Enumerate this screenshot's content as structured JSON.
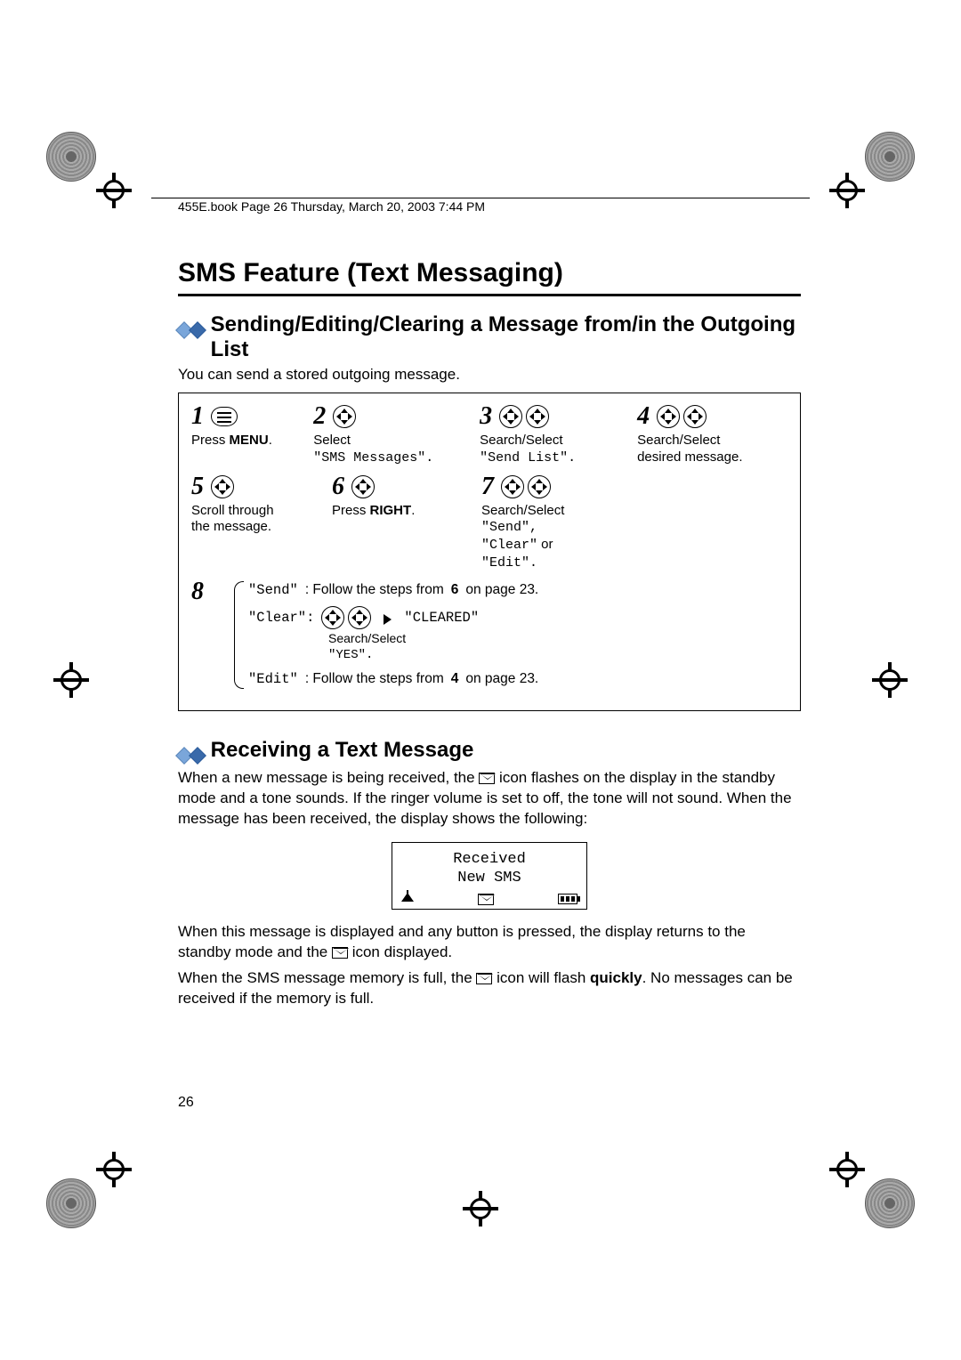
{
  "meta": {
    "running_header": "455E.book  Page 26  Thursday, March 20, 2003  7:44 PM",
    "page_number": "26"
  },
  "title": "SMS Feature (Text Messaging)",
  "section1": {
    "heading": "Sending/Editing/Clearing a Message from/in the Outgoing List",
    "intro": "You can send a stored outgoing message.",
    "steps": {
      "s1": {
        "num": "1",
        "cap_pre": "Press ",
        "cap_bold": "MENU",
        "cap_post": "."
      },
      "s2": {
        "num": "2",
        "cap1": "Select",
        "cap2": "\"SMS Messages\"."
      },
      "s3": {
        "num": "3",
        "cap1": "Search/Select",
        "cap2": "\"Send List\"."
      },
      "s4": {
        "num": "4",
        "cap1": "Search/Select",
        "cap2": "desired message."
      },
      "s5": {
        "num": "5",
        "cap1": "Scroll through",
        "cap2": "the message."
      },
      "s6": {
        "num": "6",
        "cap_pre": "Press ",
        "cap_bold": "RIGHT",
        "cap_post": "."
      },
      "s7": {
        "num": "7",
        "cap1": "Search/Select",
        "cap2a": "\"Send\",",
        "cap2b": "\"Clear\"",
        "cap2c": " or",
        "cap2d": "\"Edit\"."
      }
    },
    "step8": {
      "num": "8",
      "send": {
        "label": "\"Send\"",
        "text_pre": ": Follow the steps from ",
        "text_bold": "6",
        "text_post": " on page 23."
      },
      "clear": {
        "label": "\"Clear\":",
        "subcap1": "Search/Select",
        "subcap2": "\"YES\".",
        "result": "\"CLEARED\""
      },
      "edit": {
        "label": "\"Edit\"",
        "text_pre": ": Follow the steps from ",
        "text_bold": "4",
        "text_post": " on page 23."
      }
    }
  },
  "section2": {
    "heading": "Receiving a Text Message",
    "para1_a": "When a new message is being received, the ",
    "para1_b": " icon flashes on the display in the standby mode and a tone sounds. If the ringer volume is set to off, the tone will not sound. When the message has been received, the display shows the following:",
    "lcd_line1": "Received",
    "lcd_line2": "New SMS",
    "para2_a": "When this message is displayed and any button is pressed, the display returns to the standby mode and the ",
    "para2_b": " icon displayed.",
    "para3_a": "When the SMS message memory is full, the ",
    "para3_b": " icon will flash ",
    "para3_bold": "quickly",
    "para3_c": ". No messages can be received if the memory is full."
  }
}
